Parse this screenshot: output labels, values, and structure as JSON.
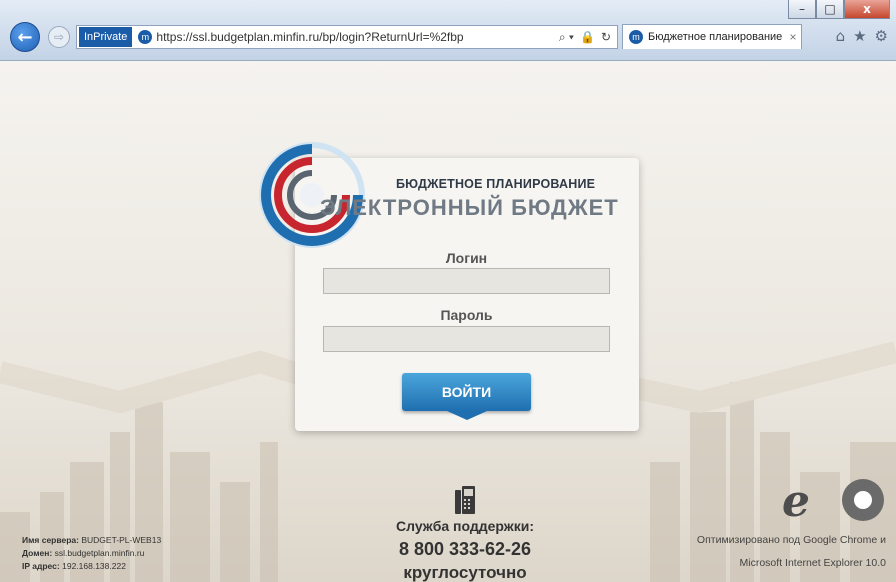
{
  "browser": {
    "back_glyph": "←",
    "forward_glyph": "⇨",
    "inprivate_label": "InPrivate",
    "url": "https://ssl.budgetplan.minfin.ru/bp/login?ReturnUrl=%2fbp",
    "site_icon_glyph": "m",
    "tab_title": "Бюджетное планирование",
    "tab_close": "×",
    "search_glyph": "⌕ ▾",
    "lock_glyph": "🔒",
    "refresh_glyph": "↻",
    "home_glyph": "⌂",
    "star_glyph": "★",
    "gear_glyph": "⚙",
    "minimize": "–",
    "maximize": "□",
    "close": "x"
  },
  "login": {
    "brand_top": "БЮДЖЕТНОЕ ПЛАНИРОВАНИЕ",
    "brand_main": "ЭЛЕКТРОННЫЙ БЮДЖЕТ",
    "login_label": "Логин",
    "login_value": "",
    "password_label": "Пароль",
    "password_value": "",
    "submit_label": "ВОЙТИ"
  },
  "support": {
    "title": "Служба поддержки:",
    "phone": "8 800 333-62-26",
    "hours": "круглосуточно"
  },
  "server": {
    "name_label": "Имя сервера:",
    "name_value": "BUDGET-PL-WEB13",
    "domain_label": "Домен:",
    "domain_value": "ssl.budgetplan.minfin.ru",
    "ip_label": "IP адрес:",
    "ip_value": "192.168.138.222"
  },
  "optimized": {
    "line1": "Оптимизировано под Google Chrome и",
    "line2": "Microsoft Internet Explorer 10.0"
  },
  "colors": {
    "accent": "#1f6fb0",
    "brand_red": "#c8262e"
  },
  "icons": [
    "back-arrow-icon",
    "forward-arrow-icon",
    "site-favicon-icon",
    "search-icon",
    "lock-icon",
    "refresh-icon",
    "home-icon",
    "favorites-star-icon",
    "settings-gear-icon",
    "phone-icon",
    "ie-logo-icon",
    "chrome-logo-icon",
    "budget-logo-icon"
  ]
}
